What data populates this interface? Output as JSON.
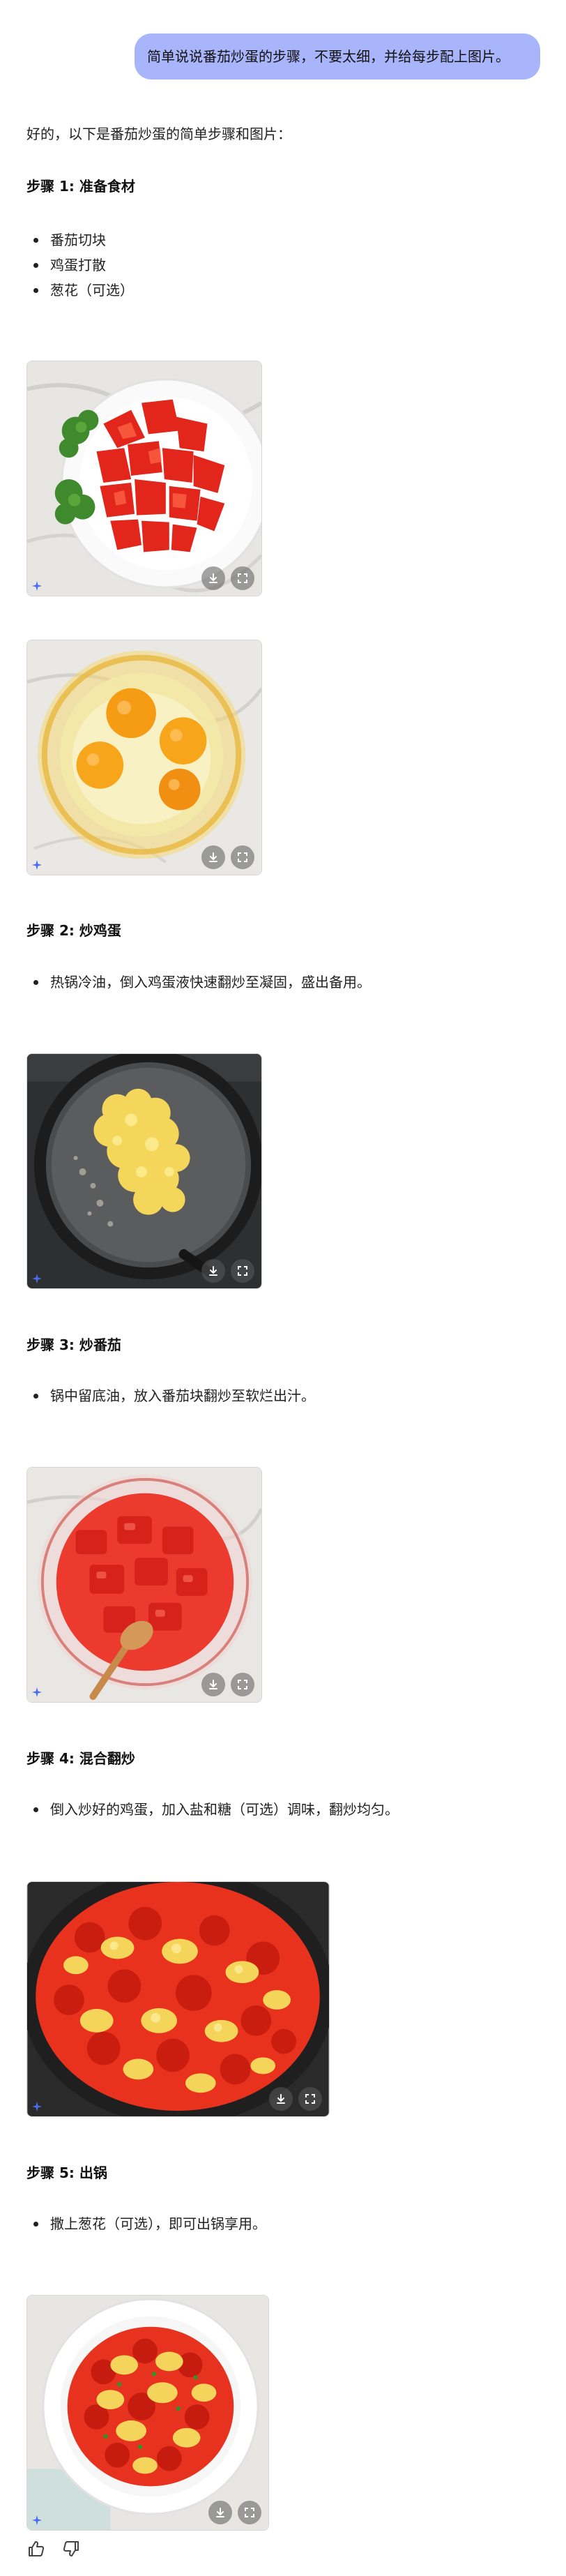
{
  "user_message": "简单说说番茄炒蛋的步骤，不要太细，并给每步配上图片。",
  "assistant": {
    "intro": "好的，以下是番茄炒蛋的简单步骤和图片：",
    "steps": [
      {
        "title": "步骤 1: 准备食材",
        "bullets": [
          "番茄切块",
          "鸡蛋打散",
          "葱花（可选）"
        ]
      },
      {
        "title": "步骤 2: 炒鸡蛋",
        "bullets": [
          "热锅冷油，倒入鸡蛋液快速翻炒至凝固，盛出备用。"
        ]
      },
      {
        "title": "步骤 3: 炒番茄",
        "bullets": [
          "锅中留底油，放入番茄块翻炒至软烂出汁。"
        ]
      },
      {
        "title": "步骤 4: 混合翻炒",
        "bullets": [
          "倒入炒好的鸡蛋，加入盐和糖（可选）调味，翻炒均匀。"
        ]
      },
      {
        "title": "步骤 5: 出锅",
        "bullets": [
          "撒上葱花（可选），即可出锅享用。"
        ]
      }
    ]
  },
  "image_actions": [
    "download-icon",
    "expand-icon"
  ],
  "feedback_icons": [
    "thumbs-up-icon",
    "thumbs-down-icon"
  ]
}
